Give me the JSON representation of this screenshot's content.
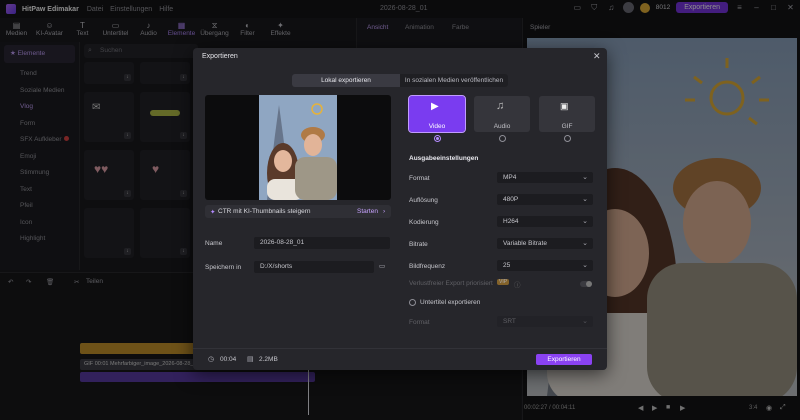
{
  "app": {
    "name": "HitPaw Edimakar",
    "menu": [
      "Datei",
      "Einstellungen",
      "Hilfe"
    ],
    "document_title": "2026-08-28_01",
    "credits": "8012",
    "export_label": "Exportieren"
  },
  "toolbar": [
    {
      "label": "Medien",
      "icon": "folder-icon"
    },
    {
      "label": "KI-Avatar",
      "icon": "avatar-icon"
    },
    {
      "label": "Text",
      "icon": "text-icon"
    },
    {
      "label": "Untertitel",
      "icon": "subtitle-icon"
    },
    {
      "label": "Audio",
      "icon": "music-icon"
    },
    {
      "label": "Elemente",
      "icon": "elements-icon"
    },
    {
      "label": "Übergang",
      "icon": "transition-icon"
    },
    {
      "label": "Filter",
      "icon": "filter-icon"
    },
    {
      "label": "Effekte",
      "icon": "effects-icon"
    }
  ],
  "sidebar": {
    "header": "Elemente",
    "items": [
      "Trend",
      "Soziale Medien",
      "Vlog",
      "Form",
      "SFX Aufkleber",
      "Emoji",
      "Stimmung",
      "Text",
      "Pfeil",
      "Icon",
      "Highlight"
    ]
  },
  "search": {
    "placeholder": "Suchen"
  },
  "properties": {
    "tabs": [
      "Ansicht",
      "Animation",
      "Farbe"
    ]
  },
  "player": {
    "title": "Spieler",
    "current_time": "00:02:27",
    "total_time": "00:04:11",
    "zoom": "3:4"
  },
  "timeline": {
    "split_label": "Teilen",
    "clip_label": "GIF 00:01 Mehrfarbiger_image_2026-08-28_01"
  },
  "modal": {
    "title": "Exportieren",
    "tabs": [
      "Lokal exportieren",
      "In sozialen Medien veröffentlichen"
    ],
    "formats": [
      "Video",
      "Audio",
      "GIF"
    ],
    "ctr_text": "CTR mit KI-Thumbnails steigern",
    "ctr_action": "Starten",
    "name_label": "Name",
    "name_value": "2026-08-28_01",
    "save_label": "Speichern in",
    "save_value": "D:/X/shorts",
    "settings_title": "Ausgabeeinstellungen",
    "settings": [
      {
        "label": "Format",
        "value": "MP4"
      },
      {
        "label": "Auflösung",
        "value": "480P"
      },
      {
        "label": "Kodierung",
        "value": "H264"
      },
      {
        "label": "Bitrate",
        "value": "Variable Bitrate"
      },
      {
        "label": "Bildfrequenz",
        "value": "25"
      }
    ],
    "accel_label": "Verlustfreier Export priorisiert",
    "subtitle_label": "Untertitel exportieren",
    "subtitle_format_label": "Format",
    "subtitle_format_value": "SRT",
    "duration": "00:04",
    "size": "2.2MB",
    "export_button": "Exportieren"
  },
  "colors": {
    "accent": "#8a42f2",
    "background": "#1b1b1e",
    "modal": "#26262b"
  }
}
